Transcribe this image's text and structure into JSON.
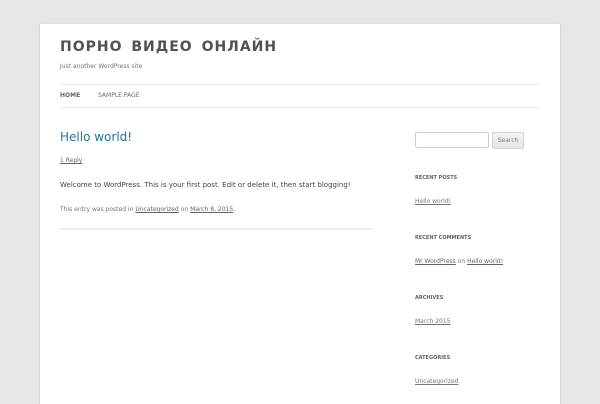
{
  "site": {
    "title": "ПОРНО ВИДЕО ОНЛАЙН",
    "description": "Just another WordPress site"
  },
  "nav": [
    {
      "label": "Home",
      "current": true
    },
    {
      "label": "Sample Page",
      "current": false
    }
  ],
  "post": {
    "title": "Hello world!",
    "replies": "1 Reply",
    "content": "Welcome to WordPress. This is your first post. Edit or delete it, then start blogging!",
    "meta_prefix": "This entry was posted in ",
    "category": "Uncategorized",
    "meta_on": " on ",
    "date": "March 8, 2015",
    "meta_end": "."
  },
  "sidebar": {
    "search_button": "Search",
    "recent_posts": {
      "title": "Recent Posts",
      "items": [
        "Hello world!"
      ]
    },
    "recent_comments": {
      "title": "Recent Comments",
      "author": "Mr WordPress",
      "on": " on ",
      "post": "Hello world!"
    },
    "archives": {
      "title": "Archives",
      "items": [
        "March 2015"
      ]
    },
    "categories": {
      "title": "Categories",
      "items": [
        "Uncategorized"
      ]
    }
  },
  "colors": {
    "link": "#21759b",
    "background": "#e6e6e6"
  }
}
